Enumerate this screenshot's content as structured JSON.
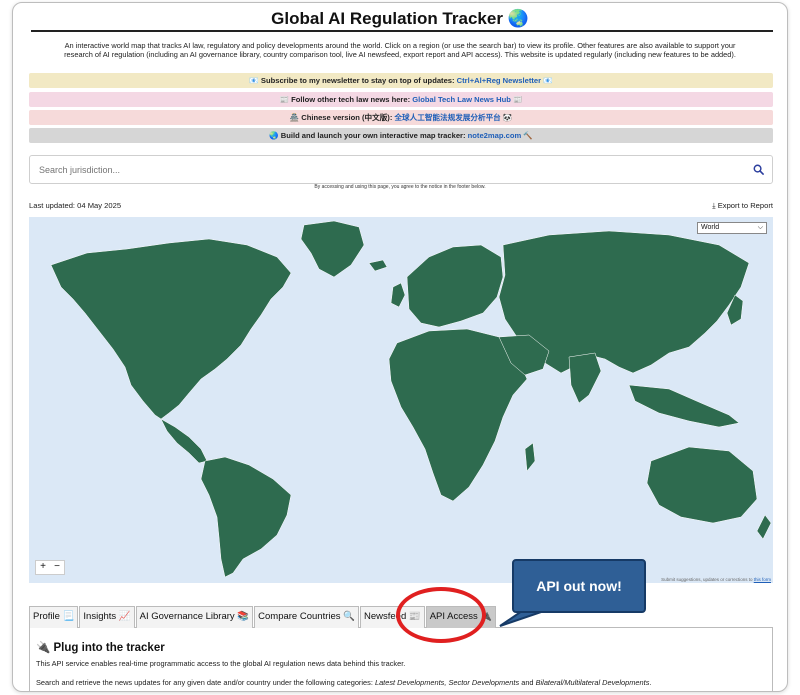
{
  "page": {
    "title": "Global AI Regulation Tracker 🌏",
    "intro": "An interactive world map that tracks AI law, regulatory and policy developments around the world. Click on a region (or use the search bar) to view its profile. Other features are also available to support your research of AI regulation (including an AI governance library, country comparison tool, live AI newsfeed, export report and API access). This website is updated regularly (including new features to be added)."
  },
  "banners": [
    {
      "prefix": "📧 Subscribe to my newsletter to stay on top of updates: ",
      "link": "Ctrl+Al+Reg Newsletter",
      "suffix": " 📧",
      "color": "#f2e9c4"
    },
    {
      "prefix": "📰 Follow other tech law news here: ",
      "link": "Global Tech Law News Hub",
      "suffix": " 📰",
      "color": "#f4d8e4"
    },
    {
      "prefix": "🏯 Chinese version (中文版): ",
      "link": "全球人工智能法规发展分析平台",
      "suffix": " 🐼",
      "color": "#f6dada"
    },
    {
      "prefix": "🌏 Build and launch your own interactive map tracker: ",
      "link": "note2map.com",
      "suffix": " 🔨",
      "color": "#d6d6d6"
    }
  ],
  "search": {
    "placeholder": "Search jurisdiction..."
  },
  "notice": "By accessing and using this page, you agree to the notice in the footer below.",
  "last_updated": "Last updated: 04 May 2025",
  "export_label": "Export to Report",
  "map": {
    "region_selected": "World",
    "zoom_in": "+",
    "zoom_out": "−",
    "attribution": "Submit suggestions, updates or corrections to ",
    "attribution_link": "this form",
    "ocean_color": "#dbe8f6",
    "land_color": "#2e6b4f"
  },
  "tabs": [
    {
      "label": "Profile 📃"
    },
    {
      "label": "Insights 📈"
    },
    {
      "label": "AI Governance Library 📚"
    },
    {
      "label": "Compare Countries 🔍"
    },
    {
      "label": "Newsfeed 📰"
    },
    {
      "label": "API Access 🔌",
      "active": true
    }
  ],
  "api_panel": {
    "heading": "🔌 Plug into the tracker",
    "line1": "This API service enables real-time programmatic access to the global AI regulation news data behind this tracker.",
    "line2_prefix": "Search and retrieve the news updates for any given date and/or country under the following categories: ",
    "line2_cats": "Latest Developments, Sector Developments",
    "line2_and": " and ",
    "line2_last": "Bilateral/Multilateral Developments",
    "line2_end": "."
  },
  "callout": {
    "text": "API out now!"
  }
}
